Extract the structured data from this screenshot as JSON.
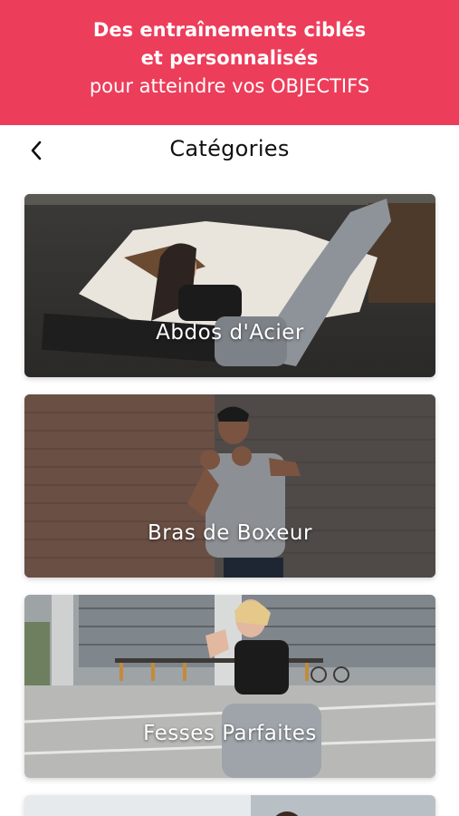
{
  "promo": {
    "line1": "Des entraînements ciblés",
    "line2": "et personnalisés",
    "line3": "pour atteindre vos OBJECTIFS"
  },
  "nav": {
    "back_icon": "chevron-left-icon",
    "title": "Catégories"
  },
  "categories": [
    {
      "label": "Abdos d'Acier"
    },
    {
      "label": "Bras de Boxeur"
    },
    {
      "label": "Fesses Parfaites"
    }
  ],
  "colors": {
    "accent": "#ec3d5a",
    "text": "#111111"
  }
}
